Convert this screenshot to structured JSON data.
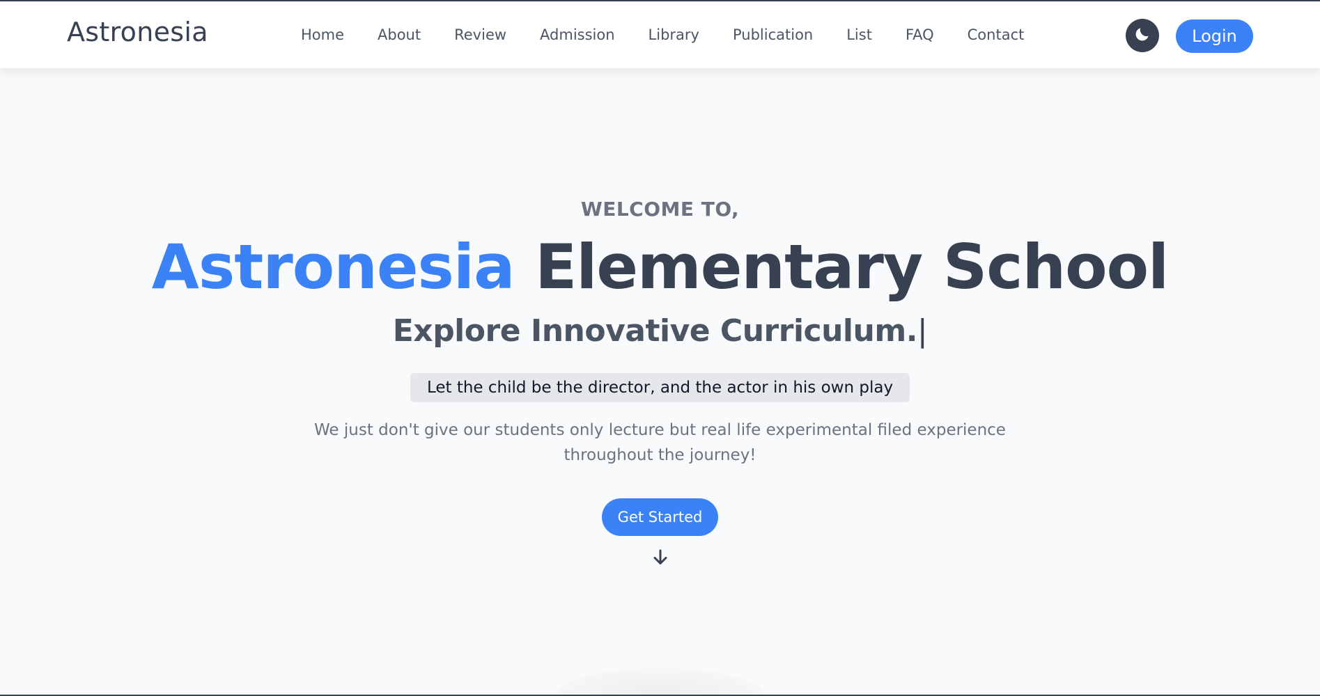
{
  "navbar": {
    "brand": "Astronesia",
    "links": [
      {
        "label": "Home"
      },
      {
        "label": "About"
      },
      {
        "label": "Review"
      },
      {
        "label": "Admission"
      },
      {
        "label": "Library"
      },
      {
        "label": "Publication"
      },
      {
        "label": "List"
      },
      {
        "label": "FAQ"
      },
      {
        "label": "Contact"
      }
    ],
    "theme_toggle_icon": "moon-icon",
    "login_label": "Login"
  },
  "hero": {
    "welcome": "WELCOME TO,",
    "headline_accent": "Astronesia",
    "headline_rest": "Elementary School",
    "typed_text": "Explore Innovative Curriculum.",
    "typed_cursor": "|",
    "quote": "Let the child be the director, and the actor in his own play",
    "description": "We just don't give our students only lecture but real life experimental filed experience throughout the journey!",
    "cta_label": "Get Started",
    "scroll_icon": "arrow-down-icon"
  },
  "colors": {
    "accent": "#3b82f6",
    "text_dark": "#374151",
    "text_muted": "#6b7280",
    "background": "#f8fafc",
    "quote_bg": "#e5e7eb"
  }
}
